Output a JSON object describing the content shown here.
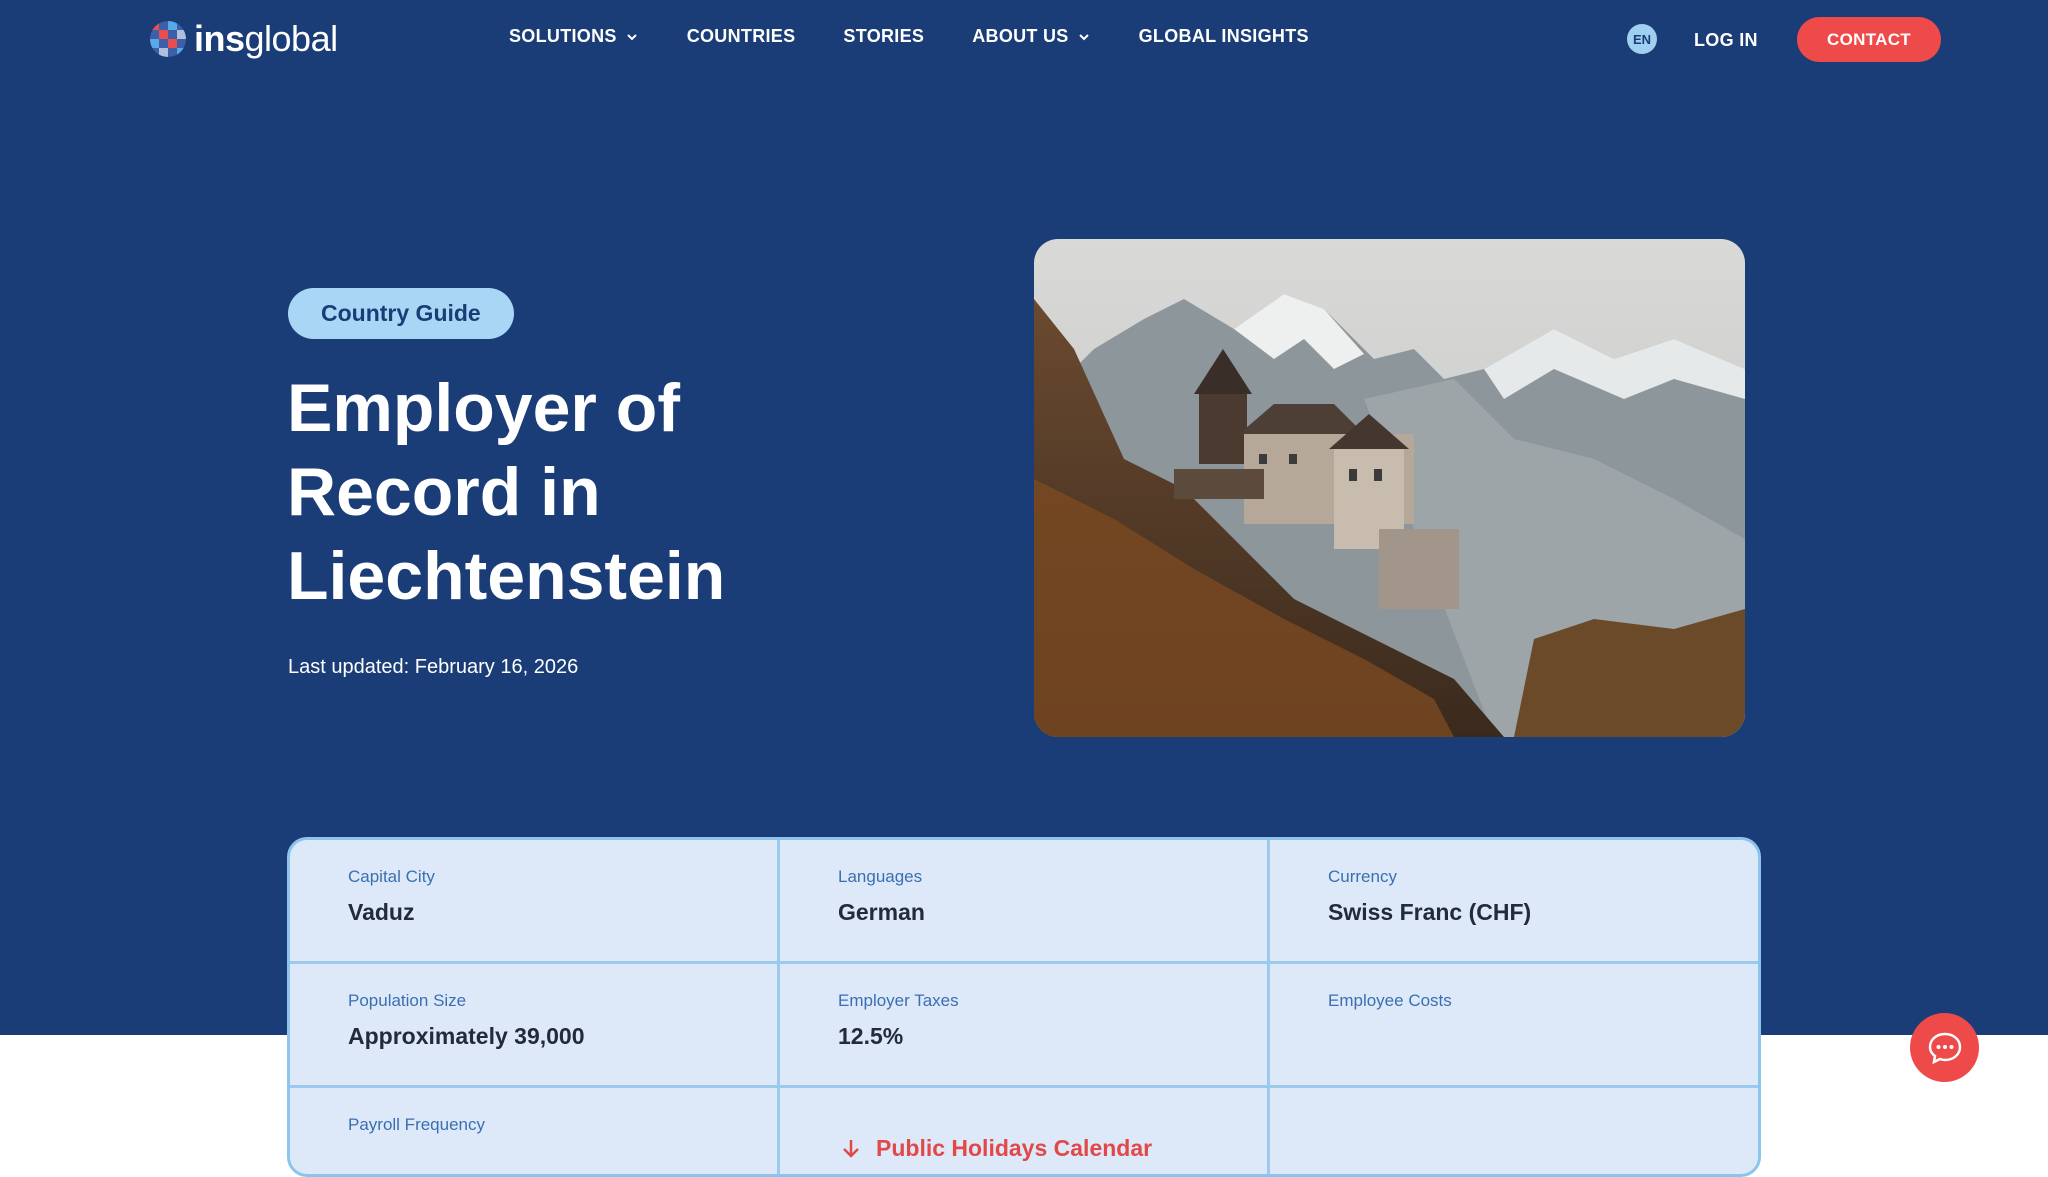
{
  "brand": {
    "logo_bold": "ins",
    "logo_light": "global"
  },
  "nav": {
    "items": [
      {
        "label": "SOLUTIONS",
        "dropdown": true
      },
      {
        "label": "COUNTRIES",
        "dropdown": false
      },
      {
        "label": "STORIES",
        "dropdown": false
      },
      {
        "label": "ABOUT US",
        "dropdown": true
      },
      {
        "label": "GLOBAL INSIGHTS",
        "dropdown": false
      }
    ],
    "language": "EN",
    "login": "LOG IN",
    "contact": "CONTACT"
  },
  "hero": {
    "badge": "Country Guide",
    "title": "Employer of Record in Liechtenstein",
    "updated": "Last updated: February 16, 2026",
    "image_icon": "castle-mountain-photo"
  },
  "facts": [
    {
      "label": "Capital City",
      "value": "Vaduz"
    },
    {
      "label": "Languages",
      "value": "German"
    },
    {
      "label": "Currency",
      "value": "Swiss Franc (CHF)"
    },
    {
      "label": "Population Size",
      "value": "Approximately 39,000"
    },
    {
      "label": "Employer Taxes",
      "value": "12.5%"
    },
    {
      "label": "Employee Costs",
      "value": ""
    },
    {
      "label": "Payroll Frequency",
      "value": ""
    }
  ],
  "holidays_link": "Public Holidays Calendar",
  "colors": {
    "hero_bg": "#1a3d77",
    "accent_red": "#ee4a4a",
    "badge_bg": "#a8d6f4",
    "table_bg": "#dde9f9"
  }
}
